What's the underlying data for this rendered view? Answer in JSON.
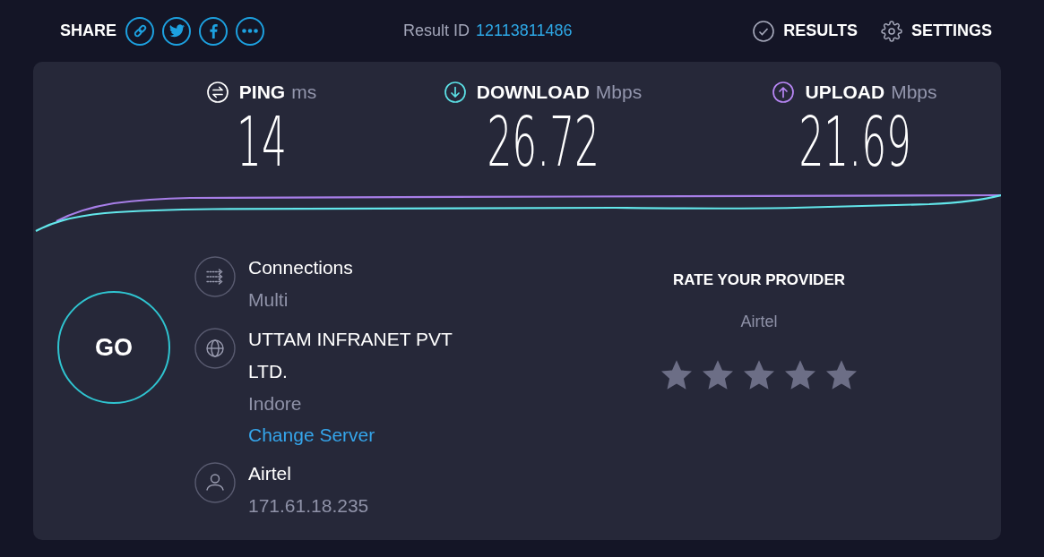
{
  "header": {
    "share": {
      "label": "SHARE"
    },
    "result_id": {
      "label": "Result ID",
      "value": "12113811486"
    },
    "nav": [
      {
        "kind": "results",
        "label": "RESULTS"
      },
      {
        "kind": "settings",
        "label": "SETTINGS"
      }
    ]
  },
  "metrics": [
    {
      "kind": "ping",
      "label": "PING",
      "unit": "ms",
      "value": "14"
    },
    {
      "kind": "download",
      "label": "DOWNLOAD",
      "unit": "Mbps",
      "value": "26.72"
    },
    {
      "kind": "upload",
      "label": "UPLOAD",
      "unit": "Mbps",
      "value": "21.69"
    }
  ],
  "go_button": {
    "label": "GO"
  },
  "server_info": [
    {
      "kind": "connections",
      "title": "Connections",
      "subtitle": "Multi"
    },
    {
      "kind": "server",
      "title": "UTTAM INFRANET PVT LTD.",
      "subtitle": "Indore",
      "link": "Change Server"
    },
    {
      "kind": "provider",
      "title": "Airtel",
      "subtitle": "171.61.18.235"
    }
  ],
  "rating": {
    "title": "RATE YOUR PROVIDER",
    "provider": "Airtel"
  }
}
